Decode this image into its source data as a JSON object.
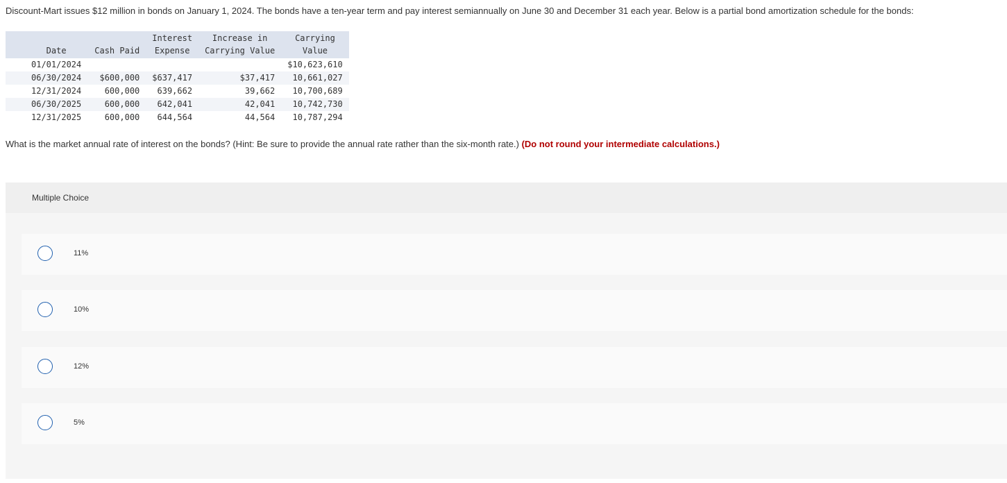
{
  "problem": {
    "intro": "Discount-Mart issues $12 million in bonds on January 1, 2024. The bonds have a ten-year term and pay interest semiannually on June 30 and December 31 each year. Below is a partial bond amortization schedule for the bonds:",
    "question": "What is the market annual rate of interest on the bonds? (Hint: Be sure to provide the annual rate rather than the six-month rate.)",
    "emphasis": "(Do not round your intermediate calculations.)"
  },
  "schedule": {
    "headers": [
      {
        "line1": "",
        "line2": "Date"
      },
      {
        "line1": "",
        "line2": "Cash Paid"
      },
      {
        "line1": "Interest",
        "line2": "Expense"
      },
      {
        "line1": "Increase in",
        "line2": "Carrying Value"
      },
      {
        "line1": "Carrying",
        "line2": "Value"
      }
    ],
    "rows": [
      [
        "01/01/2024",
        "",
        "",
        "",
        "$10,623,610"
      ],
      [
        "06/30/2024",
        "$600,000",
        "$637,417",
        "$37,417",
        "10,661,027"
      ],
      [
        "12/31/2024",
        "600,000",
        "639,662",
        "39,662",
        "10,700,689"
      ],
      [
        "06/30/2025",
        "600,000",
        "642,041",
        "42,041",
        "10,742,730"
      ],
      [
        "12/31/2025",
        "600,000",
        "644,564",
        "44,564",
        "10,787,294"
      ]
    ]
  },
  "multiple_choice": {
    "title": "Multiple Choice",
    "options": [
      {
        "label": "11%"
      },
      {
        "label": "10%"
      },
      {
        "label": "12%"
      },
      {
        "label": "5%"
      }
    ]
  },
  "colors": {
    "header_bg": "#dde3ee",
    "alt_row_bg": "#f2f4f8",
    "emphasis": "#b00000",
    "radio_border": "#1f5fae"
  }
}
